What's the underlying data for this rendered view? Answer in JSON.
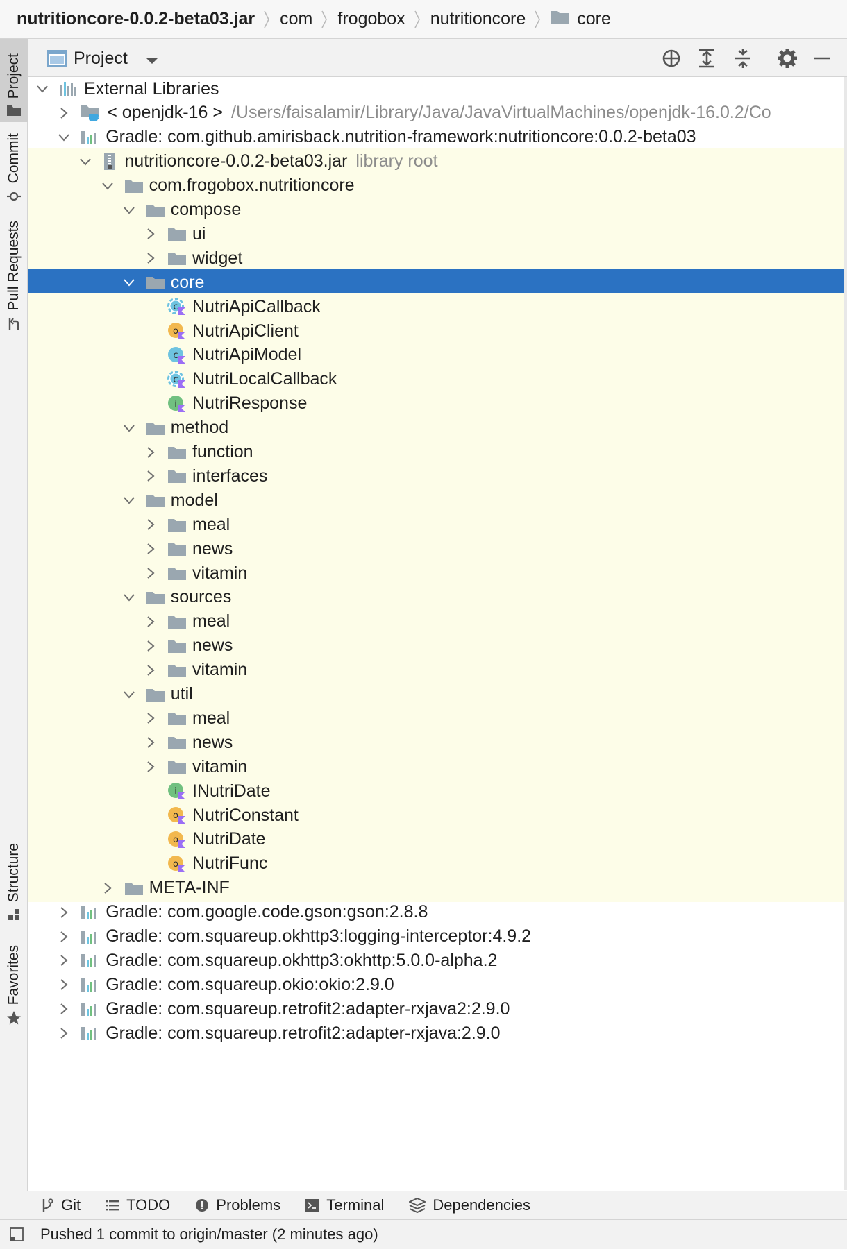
{
  "breadcrumb": [
    "nutritioncore-0.0.2-beta03.jar",
    "com",
    "frogobox",
    "nutritioncore",
    "core"
  ],
  "left_tabs": [
    {
      "label": "Project",
      "icon": "folder-icon",
      "active": true
    },
    {
      "label": "Commit",
      "icon": "commit-icon",
      "active": false
    },
    {
      "label": "Pull Requests",
      "icon": "pull-request-icon",
      "active": false
    },
    {
      "label": "Structure",
      "icon": "structure-icon",
      "active": false
    },
    {
      "label": "Favorites",
      "icon": "star-icon",
      "active": false
    }
  ],
  "tool_window": {
    "title": "Project",
    "buttons": [
      "locate-icon",
      "expand-all-icon",
      "collapse-all-icon",
      "gear-icon",
      "hide-icon"
    ]
  },
  "colors": {
    "selection": "#2b72c2",
    "library_highlight": "#fdfde8",
    "folder": "#9aa7b0",
    "class_badge": "#6ec3e0",
    "object_badge": "#f2b84e",
    "interface_badge": "#71c080",
    "kotlin_badge": "#9b6ff5"
  },
  "tree": [
    {
      "label": "External Libraries",
      "depth": 0,
      "arrow": "down",
      "icon": "libraries-icon"
    },
    {
      "label": "< openjdk-16 >",
      "secondary": "/Users/faisalamir/Library/Java/JavaVirtualMachines/openjdk-16.0.2/Co",
      "depth": 1,
      "arrow": "right",
      "icon": "jdk-icon"
    },
    {
      "label": "Gradle: com.github.amirisback.nutrition-framework:nutritioncore:0.0.2-beta03",
      "depth": 1,
      "arrow": "down",
      "icon": "library-icon"
    },
    {
      "label": "nutritioncore-0.0.2-beta03.jar",
      "secondary": "library root",
      "depth": 2,
      "arrow": "down",
      "icon": "jar-icon",
      "highlight": true
    },
    {
      "label": "com.frogobox.nutritioncore",
      "depth": 3,
      "arrow": "down",
      "icon": "package-icon",
      "highlight": true
    },
    {
      "label": "compose",
      "depth": 4,
      "arrow": "down",
      "icon": "folder-icon",
      "highlight": true
    },
    {
      "label": "ui",
      "depth": 5,
      "arrow": "right",
      "icon": "folder-icon",
      "highlight": true
    },
    {
      "label": "widget",
      "depth": 5,
      "arrow": "right",
      "icon": "folder-icon",
      "highlight": true
    },
    {
      "label": "core",
      "depth": 4,
      "arrow": "down",
      "icon": "folder-icon",
      "selected": true
    },
    {
      "label": "NutriApiCallback",
      "depth": 5,
      "arrow": "none",
      "icon": "kotlin-abstract-class-icon",
      "highlight": true
    },
    {
      "label": "NutriApiClient",
      "depth": 5,
      "arrow": "none",
      "icon": "kotlin-object-icon",
      "highlight": true
    },
    {
      "label": "NutriApiModel",
      "depth": 5,
      "arrow": "none",
      "icon": "kotlin-class-icon",
      "highlight": true
    },
    {
      "label": "NutriLocalCallback",
      "depth": 5,
      "arrow": "none",
      "icon": "kotlin-abstract-class-icon",
      "highlight": true
    },
    {
      "label": "NutriResponse",
      "depth": 5,
      "arrow": "none",
      "icon": "kotlin-interface-icon",
      "highlight": true
    },
    {
      "label": "method",
      "depth": 4,
      "arrow": "down",
      "icon": "folder-icon",
      "highlight": true
    },
    {
      "label": "function",
      "depth": 5,
      "arrow": "right",
      "icon": "folder-icon",
      "highlight": true
    },
    {
      "label": "interfaces",
      "depth": 5,
      "arrow": "right",
      "icon": "folder-icon",
      "highlight": true
    },
    {
      "label": "model",
      "depth": 4,
      "arrow": "down",
      "icon": "folder-icon",
      "highlight": true
    },
    {
      "label": "meal",
      "depth": 5,
      "arrow": "right",
      "icon": "folder-icon",
      "highlight": true
    },
    {
      "label": "news",
      "depth": 5,
      "arrow": "right",
      "icon": "folder-icon",
      "highlight": true
    },
    {
      "label": "vitamin",
      "depth": 5,
      "arrow": "right",
      "icon": "folder-icon",
      "highlight": true
    },
    {
      "label": "sources",
      "depth": 4,
      "arrow": "down",
      "icon": "folder-icon",
      "highlight": true
    },
    {
      "label": "meal",
      "depth": 5,
      "arrow": "right",
      "icon": "folder-icon",
      "highlight": true
    },
    {
      "label": "news",
      "depth": 5,
      "arrow": "right",
      "icon": "folder-icon",
      "highlight": true
    },
    {
      "label": "vitamin",
      "depth": 5,
      "arrow": "right",
      "icon": "folder-icon",
      "highlight": true
    },
    {
      "label": "util",
      "depth": 4,
      "arrow": "down",
      "icon": "folder-icon",
      "highlight": true
    },
    {
      "label": "meal",
      "depth": 5,
      "arrow": "right",
      "icon": "folder-icon",
      "highlight": true
    },
    {
      "label": "news",
      "depth": 5,
      "arrow": "right",
      "icon": "folder-icon",
      "highlight": true
    },
    {
      "label": "vitamin",
      "depth": 5,
      "arrow": "right",
      "icon": "folder-icon",
      "highlight": true
    },
    {
      "label": "INutriDate",
      "depth": 5,
      "arrow": "none",
      "icon": "kotlin-interface-icon",
      "highlight": true
    },
    {
      "label": "NutriConstant",
      "depth": 5,
      "arrow": "none",
      "icon": "kotlin-object-icon",
      "highlight": true
    },
    {
      "label": "NutriDate",
      "depth": 5,
      "arrow": "none",
      "icon": "kotlin-object-icon",
      "highlight": true
    },
    {
      "label": "NutriFunc",
      "depth": 5,
      "arrow": "none",
      "icon": "kotlin-object-icon",
      "highlight": true
    },
    {
      "label": "META-INF",
      "depth": 3,
      "arrow": "right",
      "icon": "package-icon",
      "highlight": true
    },
    {
      "label": "Gradle: com.google.code.gson:gson:2.8.8",
      "depth": 1,
      "arrow": "right",
      "icon": "library-icon"
    },
    {
      "label": "Gradle: com.squareup.okhttp3:logging-interceptor:4.9.2",
      "depth": 1,
      "arrow": "right",
      "icon": "library-icon"
    },
    {
      "label": "Gradle: com.squareup.okhttp3:okhttp:5.0.0-alpha.2",
      "depth": 1,
      "arrow": "right",
      "icon": "library-icon"
    },
    {
      "label": "Gradle: com.squareup.okio:okio:2.9.0",
      "depth": 1,
      "arrow": "right",
      "icon": "library-icon"
    },
    {
      "label": "Gradle: com.squareup.retrofit2:adapter-rxjava2:2.9.0",
      "depth": 1,
      "arrow": "right",
      "icon": "library-icon"
    },
    {
      "label": "Gradle: com.squareup.retrofit2:adapter-rxjava:2.9.0",
      "depth": 1,
      "arrow": "right",
      "icon": "library-icon"
    }
  ],
  "bottom_tabs": [
    {
      "label": "Git",
      "icon": "git-branch-icon"
    },
    {
      "label": "TODO",
      "icon": "todo-list-icon"
    },
    {
      "label": "Problems",
      "icon": "problems-icon"
    },
    {
      "label": "Terminal",
      "icon": "terminal-icon"
    },
    {
      "label": "Dependencies",
      "icon": "dependencies-icon"
    }
  ],
  "status": {
    "text": "Pushed 1 commit to origin/master (2 minutes ago)"
  }
}
